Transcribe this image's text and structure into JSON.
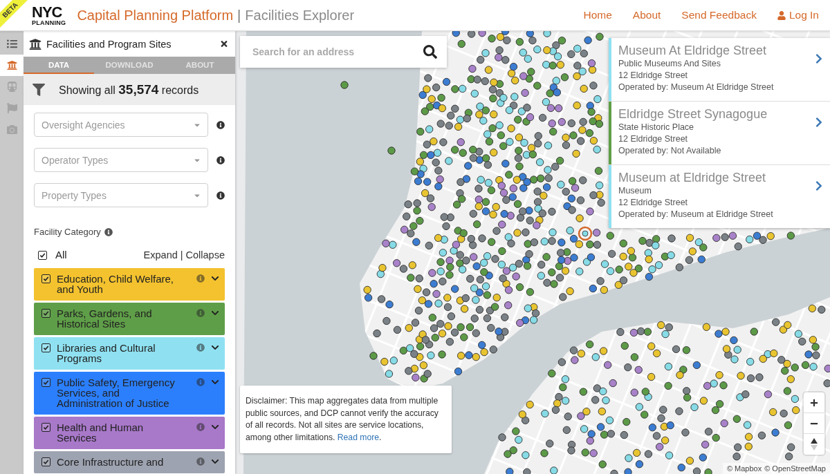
{
  "header": {
    "beta_badge": "BETA",
    "logo": {
      "top": "NYC",
      "bottom": "PLANNING"
    },
    "title": "Capital Planning Platform",
    "separator": "|",
    "subtitle": "Facilities Explorer",
    "nav": [
      {
        "label": "Home",
        "kind": "link"
      },
      {
        "label": "About",
        "kind": "link"
      },
      {
        "label": "Send Feedback",
        "kind": "link"
      },
      {
        "label": "Log In",
        "kind": "login"
      }
    ]
  },
  "rail": [
    {
      "kind": "list",
      "selected": false,
      "disabled": false
    },
    {
      "kind": "facilities",
      "selected": true,
      "disabled": false
    },
    {
      "kind": "transit",
      "selected": false,
      "disabled": true
    },
    {
      "kind": "flag",
      "selected": false,
      "disabled": true
    },
    {
      "kind": "camera",
      "selected": false,
      "disabled": true
    }
  ],
  "panel": {
    "title": "Facilities and Program Sites",
    "tabs": [
      {
        "label": "DATA",
        "selected": true
      },
      {
        "label": "DOWNLOAD",
        "selected": false
      },
      {
        "label": "ABOUT",
        "selected": false
      }
    ],
    "summary": "Showing all **35,574** records",
    "filters": [
      {
        "placeholder": "Oversight Agencies"
      },
      {
        "placeholder": "Operator Types"
      },
      {
        "placeholder": "Property Types"
      }
    ],
    "category_heading": "Facility Category",
    "all": {
      "label": "All",
      "checked": true
    },
    "expand": "Expand",
    "expand_separator": "|",
    "collapse": "Collapse",
    "categories": [
      {
        "label": "Education, Child Welfare, and Youth",
        "color": "#f3c22e",
        "checked": true
      },
      {
        "label": "Parks, Gardens, and Historical Sites",
        "color": "#5f9e48",
        "checked": true
      },
      {
        "label": "Libraries and Cultural Programs",
        "color": "#8fe1f1",
        "checked": true
      },
      {
        "label": "Public Safety, Emergency Services, and Administration of Justice",
        "color": "#2b7ffc",
        "checked": true
      },
      {
        "label": "Health and Human Services",
        "color": "#a878c9",
        "checked": true
      },
      {
        "label": "Core Infrastructure and",
        "color": "#9ea3b1",
        "checked": true
      }
    ]
  },
  "map": {
    "search": {
      "placeholder": "Search for an address"
    },
    "results": [
      {
        "title": "Museum At Eldridge Street",
        "type": "Public Museums And Sites",
        "address": "12 Eldridge Street",
        "operator": "Operated by: Museum At Eldridge Street",
        "color": "#8fe1f1"
      },
      {
        "title": "Eldridge Street Synagogue",
        "type": "State Historic Place",
        "address": "12 Eldridge Street",
        "operator": "Operated by: Not Available",
        "color": "#5f9e48"
      },
      {
        "title": "Museum at Eldridge Street",
        "type": "Museum",
        "address": "12 Eldridge Street",
        "operator": "Operated by: Museum at Eldridge Street",
        "color": "#8fe1f1"
      }
    ],
    "disclaimer": {
      "text": "Disclaimer: This map aggregates data from multiple public sources, and DCP cannot verify the accuracy of all records. Not all sites are service locations, among other limitations.",
      "link": "Read more",
      "end": "."
    },
    "attribution": [
      "© Mapbox",
      "© OpenStreetMap"
    ]
  }
}
